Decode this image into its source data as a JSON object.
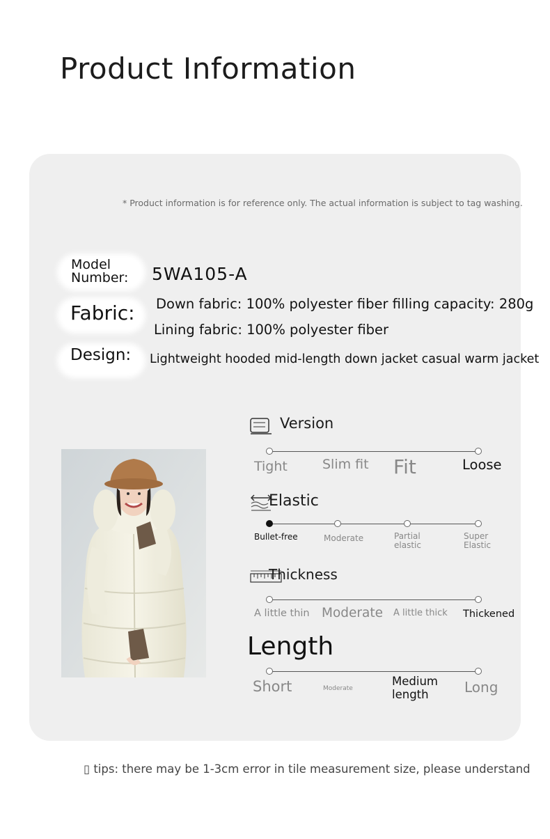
{
  "page": {
    "title": "Product Information",
    "disclaimer": "* Product information is for reference only. The actual information is subject to tag washing.",
    "tip": "▯ tips: there may be 1-3cm error in tile measurement size, please understand"
  },
  "specs": {
    "model_label_line1": "Model",
    "model_label_line2": "Number:",
    "model_value": "5WA105-A",
    "fabric_label": "Fabric:",
    "fabric_line1": "Down fabric: 100% polyester fiber filling capacity: 280g",
    "fabric_line2": "Lining fabric: 100% polyester fiber",
    "design_label": "Design:",
    "design_value": "Lightweight hooded mid-length down jacket casual warm jacket"
  },
  "attributes": {
    "version": {
      "title": "Version",
      "icon": "folded-shirt-icon",
      "options": [
        "Tight",
        "Slim fit",
        "Fit",
        "Loose"
      ],
      "selected": "Loose"
    },
    "elastic": {
      "title": "Elastic",
      "icon": "stretch-arrows-icon",
      "options": [
        "Bullet-free",
        "Moderate",
        "Partial",
        "elastic",
        "Super",
        "Elastic"
      ],
      "selected": "Bullet-free"
    },
    "thickness": {
      "title": "Thickness",
      "icon": "ruler-icon",
      "options": [
        "A little thin",
        "Moderate",
        "A little thick",
        "Thickened"
      ],
      "selected": "Thickened"
    },
    "length": {
      "title": "Length",
      "options": [
        "Short",
        "Moderate",
        "Medium",
        "length",
        "Long"
      ],
      "selected": "Medium length"
    }
  },
  "colors": {
    "card_bg": "#efefef",
    "jacket": "#f1efe2",
    "hat": "#b07a4a",
    "glove": "#6e5a48"
  }
}
